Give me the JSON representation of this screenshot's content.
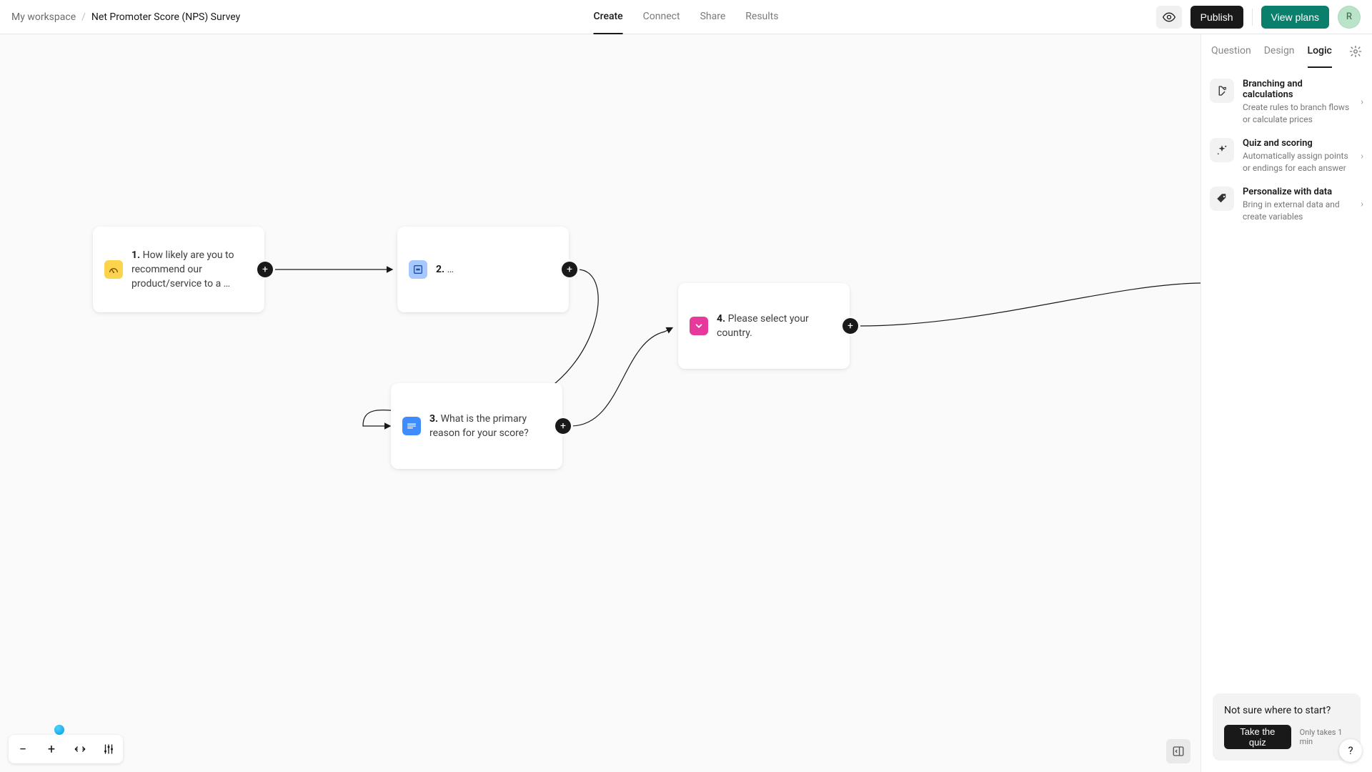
{
  "header": {
    "workspace": "My workspace",
    "separator": "/",
    "form_title": "Net Promoter Score (NPS) Survey",
    "tabs": {
      "create": "Create",
      "connect": "Connect",
      "share": "Share",
      "results": "Results"
    },
    "publish": "Publish",
    "view_plans": "View plans",
    "avatar_initial": "R"
  },
  "canvas": {
    "nodes": {
      "n1": {
        "num": "1.",
        "label": "How likely are you to recommend our product/service to a …"
      },
      "n2": {
        "num": "2.",
        "label": "…"
      },
      "n3": {
        "num": "3.",
        "label": "What is the primary reason for your score?"
      },
      "n4": {
        "num": "4.",
        "label": "Please select your country."
      }
    }
  },
  "sidebar": {
    "tabs": {
      "question": "Question",
      "design": "Design",
      "logic": "Logic"
    },
    "items": [
      {
        "title": "Branching and calculations",
        "desc": "Create rules to branch flows or calculate prices"
      },
      {
        "title": "Quiz and scoring",
        "desc": "Automatically assign points or endings for each answer"
      },
      {
        "title": "Personalize with data",
        "desc": "Bring in external data and create variables"
      }
    ],
    "quiz": {
      "heading": "Not sure where to start?",
      "button": "Take the quiz",
      "hint": "Only takes 1 min"
    }
  },
  "help": "?"
}
